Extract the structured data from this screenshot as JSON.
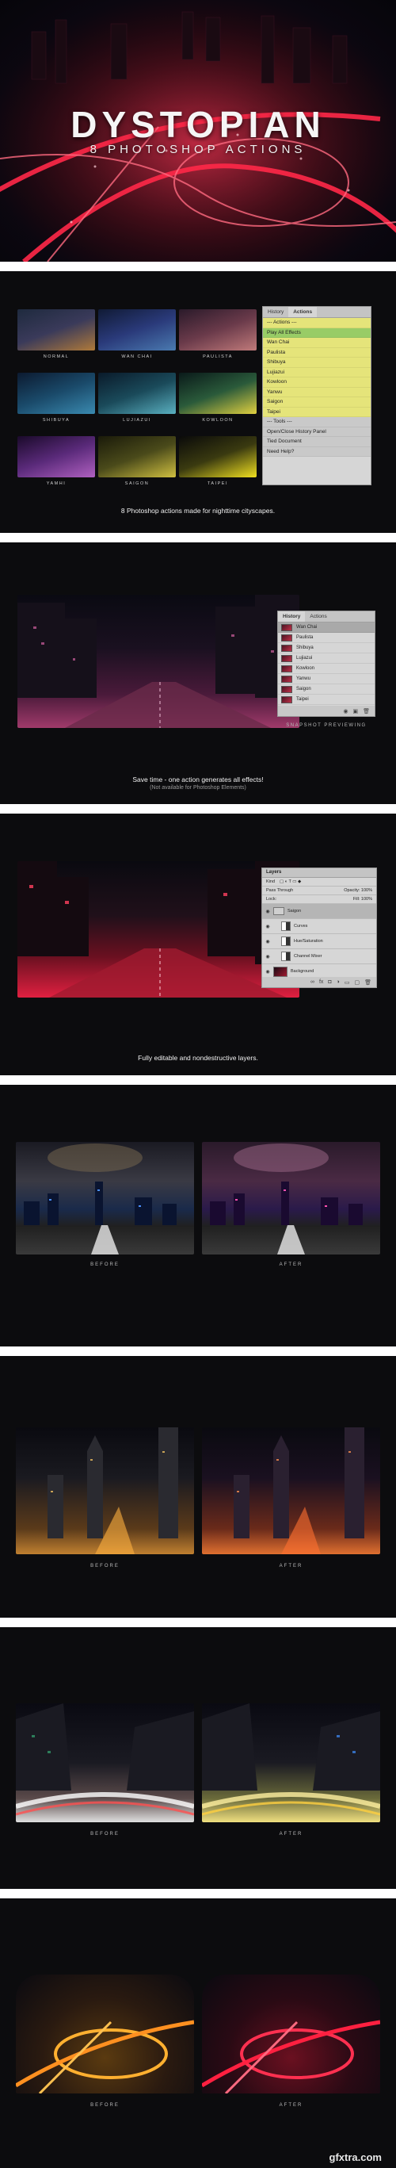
{
  "hero": {
    "title": "DYSTOPIAN",
    "subtitle": "8 PHOTOSHOP ACTIONS"
  },
  "section1": {
    "thumbnails": [
      {
        "label": "NORMAL"
      },
      {
        "label": "WAN CHAI"
      },
      {
        "label": "PAULISTA"
      },
      {
        "label": "SHIBUYA"
      },
      {
        "label": "LUJIAZUI"
      },
      {
        "label": "KOWLOON"
      },
      {
        "label": "YAMHI"
      },
      {
        "label": "SAIGON"
      },
      {
        "label": "TAIPEI"
      }
    ],
    "actions_panel": {
      "tab_history": "History",
      "tab_actions": "Actions",
      "items": [
        {
          "label": "--- Actions ---",
          "style": "yellow"
        },
        {
          "label": "Play All Effects",
          "style": "green"
        },
        {
          "label": "Wan Chai",
          "style": "yellow"
        },
        {
          "label": "Paulista",
          "style": "yellow"
        },
        {
          "label": "Shibuya",
          "style": "yellow"
        },
        {
          "label": "Lujiazui",
          "style": "yellow"
        },
        {
          "label": "Kowloon",
          "style": "yellow"
        },
        {
          "label": "Yanwu",
          "style": "yellow"
        },
        {
          "label": "Saigon",
          "style": "yellow"
        },
        {
          "label": "Taipei",
          "style": "yellow"
        },
        {
          "label": "--- Tools ---",
          "style": "gray"
        },
        {
          "label": "Open/Close History Panel",
          "style": "gray"
        },
        {
          "label": "Tied Document",
          "style": "gray"
        },
        {
          "label": "Need Help?",
          "style": "gray"
        }
      ]
    },
    "caption": "8 Photoshop actions made for nighttime cityscapes."
  },
  "section2": {
    "history_panel": {
      "tab_history": "History",
      "tab_actions": "Actions",
      "items": [
        "Wan Chai",
        "Paulista",
        "Shibuya",
        "Lujiazui",
        "Kowloon",
        "Yanwu",
        "Saigon",
        "Taipei"
      ]
    },
    "panel_label": "SNAPSHOT PREVIEWING",
    "caption": "Save time - one action generates all effects!",
    "subcaption": "(Not available for Photoshop Elements)"
  },
  "section3": {
    "layers_panel": {
      "title": "Layers",
      "kind": "Kind",
      "blend": "Pass Through",
      "opacity": "Opacity: 100%",
      "lock": "Lock:",
      "fill": "Fill: 100%",
      "layers": [
        {
          "name": "Saigon",
          "type": "group"
        },
        {
          "name": "Curves",
          "type": "adj"
        },
        {
          "name": "Hue/Saturation",
          "type": "adj"
        },
        {
          "name": "Channel Mixer",
          "type": "adj"
        },
        {
          "name": "Background",
          "type": "image"
        }
      ]
    },
    "caption": "Fully editable and nondestructive layers."
  },
  "comparisons": [
    {
      "before": "BEFORE",
      "after": "AFTER"
    },
    {
      "before": "BEFORE",
      "after": "AFTER"
    },
    {
      "before": "BEFORE",
      "after": "AFTER"
    },
    {
      "before": "BEFORE",
      "after": "AFTER"
    }
  ],
  "watermark": "gfxtra.com",
  "colors": {
    "accent_red": "#e0203e",
    "panel_bg": "#0c0c0e",
    "actions_yellow": "#e5e47a",
    "actions_green": "#98cc66"
  }
}
